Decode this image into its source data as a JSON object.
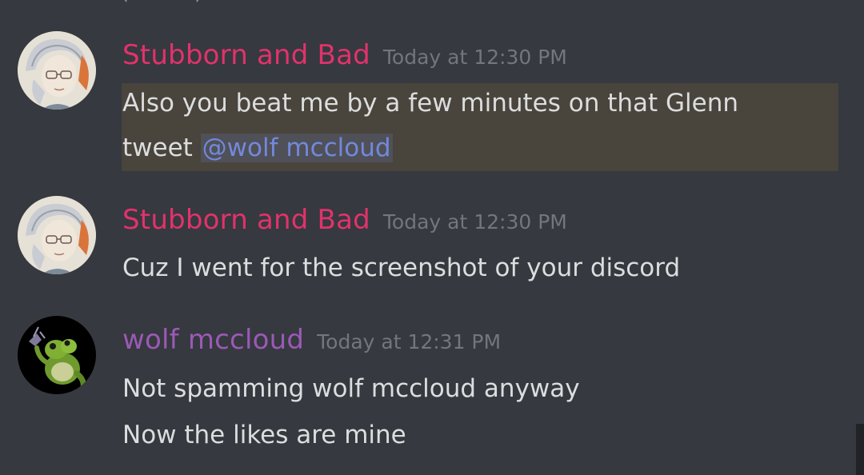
{
  "colors": {
    "background": "#36393f",
    "text": "#dcddde",
    "timestamp": "#72767d",
    "author_pink": "#e2326b",
    "author_purple": "#9b59b6",
    "mention_text": "#7289da",
    "mention_highlight_bg": "#49443c"
  },
  "messages": [
    {
      "author": "Stubborn and Bad",
      "timestamp": "Today at 12:30 PM",
      "avatar_icon": "anime-character-avatar-icon",
      "lines": [
        {
          "text": "Also you beat me by a few minutes on that Glenn"
        },
        {
          "text": "tweet ",
          "mention": "@wolf mccloud"
        }
      ]
    },
    {
      "author": "Stubborn and Bad",
      "timestamp": "Today at 12:30 PM",
      "avatar_icon": "anime-character-avatar-icon",
      "lines": [
        {
          "text": "Cuz I went for the screenshot of your discord"
        }
      ]
    },
    {
      "author": "wolf mccloud",
      "timestamp": "Today at 12:31 PM",
      "avatar_icon": "frog-character-avatar-icon",
      "lines": [
        {
          "text": "Not spamming wolf mccloud anyway"
        },
        {
          "text": "Now the likes are mine"
        }
      ]
    }
  ]
}
